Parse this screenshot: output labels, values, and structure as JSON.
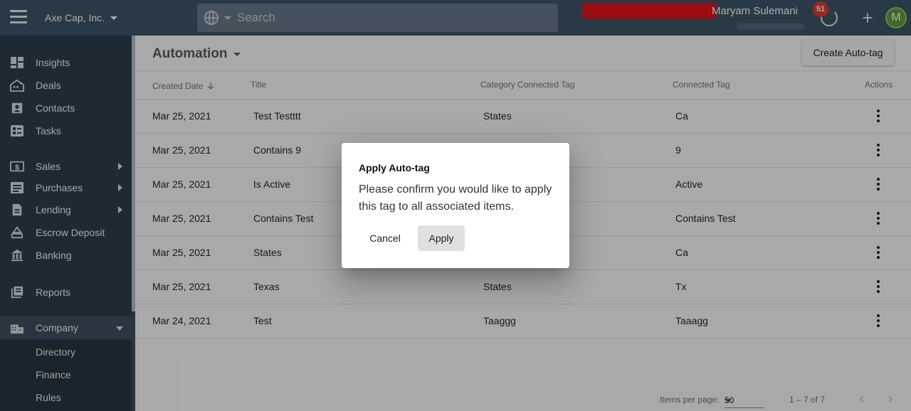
{
  "topbar": {
    "company": "Axe Cap, Inc.",
    "search_placeholder": "Search",
    "user_name": "Maryam Sulemani",
    "notification_count": "51",
    "plus_label": "+",
    "avatar_initial": "M"
  },
  "sidebar": {
    "items": [
      {
        "label": "Insights",
        "icon": "dashboard-icon"
      },
      {
        "label": "Deals",
        "icon": "deals-icon"
      },
      {
        "label": "Contacts",
        "icon": "contacts-icon"
      },
      {
        "label": "Tasks",
        "icon": "tasks-icon"
      },
      {
        "label": "Sales",
        "icon": "dollar-icon"
      },
      {
        "label": "Purchases",
        "icon": "purchases-icon"
      },
      {
        "label": "Lending",
        "icon": "document-icon"
      },
      {
        "label": "Escrow Deposit",
        "icon": "escrow-icon"
      },
      {
        "label": "Banking",
        "icon": "bank-icon"
      },
      {
        "label": "Reports",
        "icon": "reports-icon"
      },
      {
        "label": "Company",
        "icon": "building-icon"
      }
    ],
    "sub_items": [
      "Directory",
      "Finance",
      "Rules"
    ]
  },
  "main": {
    "title": "Automation",
    "create_button": "Create Auto-tag",
    "columns": {
      "created_date": "Created Date",
      "title": "Title",
      "category_tag": "Category Connected Tag",
      "connected_tag": "Connected Tag",
      "actions": "Actions"
    },
    "rows": [
      {
        "date": "Mar 25, 2021",
        "title": "Test Testttt",
        "category": "States",
        "tag": "Ca"
      },
      {
        "date": "Mar 25, 2021",
        "title": "Contains 9",
        "category": "",
        "tag": "9"
      },
      {
        "date": "Mar 25, 2021",
        "title": "Is Active",
        "category": "",
        "tag": "Active"
      },
      {
        "date": "Mar 25, 2021",
        "title": "Contains Test",
        "category": "",
        "tag": "Contains Test"
      },
      {
        "date": "Mar 25, 2021",
        "title": "States",
        "category": "",
        "tag": "Ca"
      },
      {
        "date": "Mar 25, 2021",
        "title": "Texas",
        "category": "States",
        "tag": "Tx"
      },
      {
        "date": "Mar 24, 2021",
        "title": "Test",
        "category": "Taaggg",
        "tag": "Taaagg"
      }
    ],
    "paginator": {
      "items_per_page_label": "Items per page:",
      "items_per_page_value": "50",
      "range": "1 – 7 of 7"
    }
  },
  "dialog": {
    "title": "Apply Auto-tag",
    "message": "Please confirm you would like to apply this tag to all associated items.",
    "cancel": "Cancel",
    "apply": "Apply"
  },
  "colors": {
    "topbar": "#3d5466",
    "sidebar": "#2d3e4c",
    "notification_badge": "#e53935",
    "avatar": "#5d9c3c"
  }
}
